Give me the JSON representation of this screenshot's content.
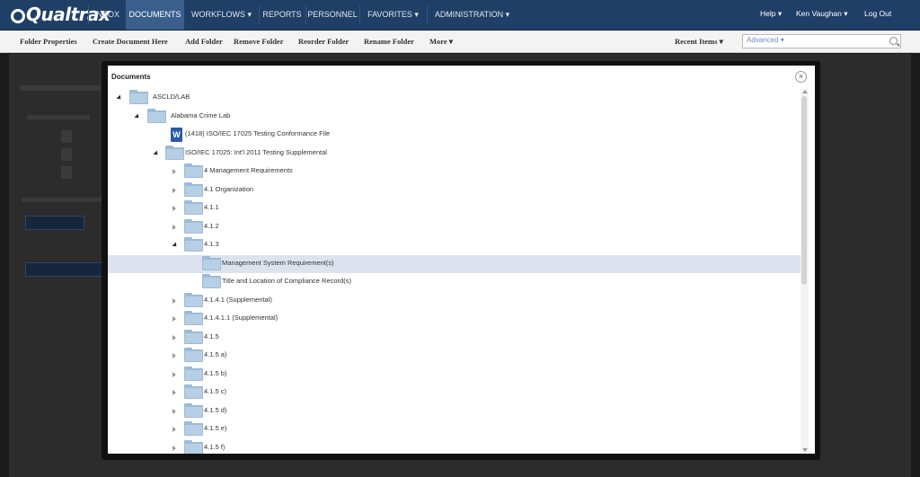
{
  "app": {
    "logo": "Qualtrax"
  },
  "nav": {
    "items": [
      "INBOX",
      "DOCUMENTS",
      "WORKFLOWS ▾",
      "REPORTS",
      "PERSONNEL",
      "FAVORITES ▾",
      "ADMINISTRATION ▾"
    ],
    "active": "DOCUMENTS",
    "help": "Help ▾",
    "user": "Ken Vaughan ▾",
    "logout": "Log Out"
  },
  "toolbar": {
    "items": [
      "Folder Properties",
      "Create Document Here",
      "Add Folder",
      "Remove Folder",
      "Reorder Folder",
      "Rename Folder",
      "More ▾"
    ],
    "recent": "Recent Items ▾",
    "search_placeholder": "Advanced ▾"
  },
  "modal": {
    "title": "Documents",
    "close": "×",
    "tree": [
      {
        "label": "ASCLD/LAB",
        "type": "folder",
        "toggle": "open"
      },
      {
        "label": "Alabama Crime Lab",
        "type": "folder",
        "toggle": "open"
      },
      {
        "label": "(1418) ISO/IEC 17025 Testing Conformance File",
        "type": "word",
        "toggle": "none"
      },
      {
        "label": "ISO/IEC 17025: Int'l 2011 Testing Supplemental",
        "type": "folder",
        "toggle": "open"
      },
      {
        "label": "4 Management Requirements",
        "type": "folder",
        "toggle": "closed"
      },
      {
        "label": "4.1 Organization",
        "type": "folder",
        "toggle": "closed"
      },
      {
        "label": "4.1.1",
        "type": "folder",
        "toggle": "closed"
      },
      {
        "label": "4.1.2",
        "type": "folder",
        "toggle": "closed"
      },
      {
        "label": "4.1.3",
        "type": "folder",
        "toggle": "open"
      },
      {
        "label": "Management System Requirement(s)",
        "type": "folder",
        "toggle": "none",
        "selected": true
      },
      {
        "label": "Title and Location of Compliance Record(s)",
        "type": "folder",
        "toggle": "none"
      },
      {
        "label": "4.1.4.1 (Supplemental)",
        "type": "folder",
        "toggle": "closed"
      },
      {
        "label": "4.1.4.1.1 (Supplemental)",
        "type": "folder",
        "toggle": "closed"
      },
      {
        "label": "4.1.5",
        "type": "folder",
        "toggle": "closed"
      },
      {
        "label": "4.1.5 a)",
        "type": "folder",
        "toggle": "closed"
      },
      {
        "label": "4.1.5 b)",
        "type": "folder",
        "toggle": "closed"
      },
      {
        "label": "4.1.5 c)",
        "type": "folder",
        "toggle": "closed"
      },
      {
        "label": "4.1.5 d)",
        "type": "folder",
        "toggle": "closed"
      },
      {
        "label": "4.1.5 e)",
        "type": "folder",
        "toggle": "closed"
      },
      {
        "label": "4.1.5 f)",
        "type": "folder",
        "toggle": "closed"
      }
    ]
  }
}
